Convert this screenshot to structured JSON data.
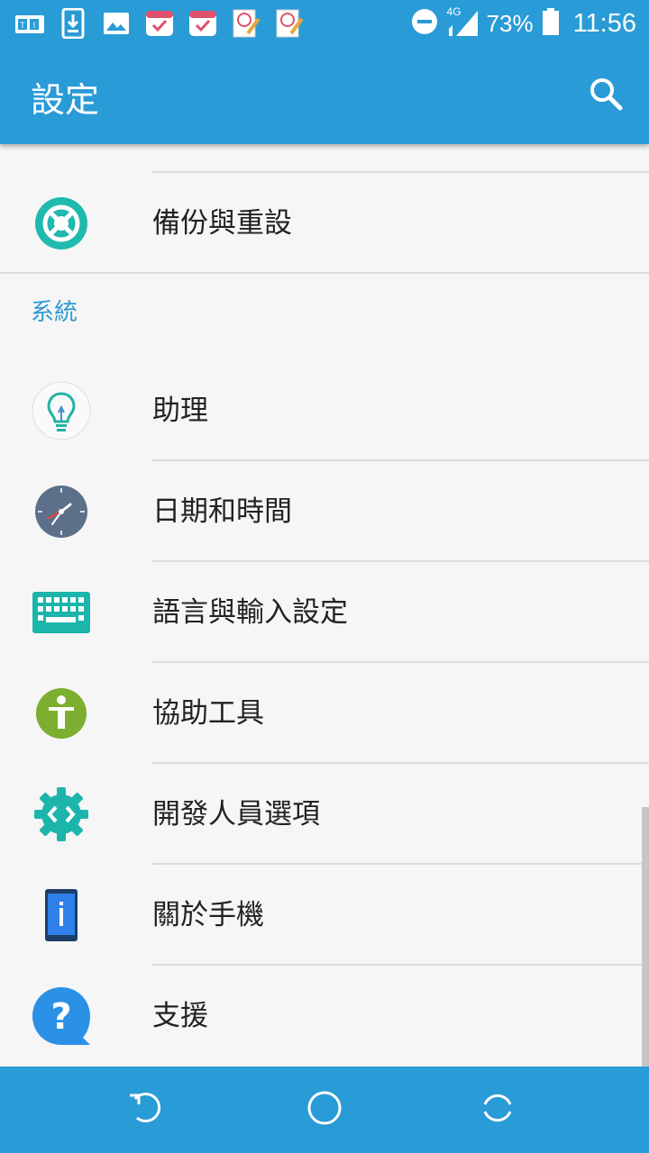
{
  "status_bar": {
    "network": "4G",
    "battery_percent": "73%",
    "battery_level": 0.73,
    "time": "11:56",
    "notification_icons": [
      "tv-icon",
      "download-icon",
      "image-icon",
      "calendar-check-icon",
      "calendar-check-icon",
      "notepad-icon",
      "notepad-icon"
    ]
  },
  "app_bar": {
    "title": "設定",
    "search_icon": "search-icon"
  },
  "settings": {
    "backup_reset": {
      "label": "備份與重設",
      "icon": "backup-icon"
    },
    "section_system": "系統",
    "items": [
      {
        "label": "助理",
        "icon": "lightbulb-icon"
      },
      {
        "label": "日期和時間",
        "icon": "clock-icon"
      },
      {
        "label": "語言與輸入設定",
        "icon": "keyboard-icon"
      },
      {
        "label": "協助工具",
        "icon": "accessibility-icon"
      },
      {
        "label": "開發人員選項",
        "icon": "developer-gear-icon"
      },
      {
        "label": "關於手機",
        "icon": "phone-info-icon"
      },
      {
        "label": "支援",
        "icon": "help-icon"
      }
    ]
  },
  "nav_bar": {
    "back_icon": "back-icon",
    "home_icon": "home-icon",
    "recents_icon": "recents-icon"
  },
  "colors": {
    "primary": "#299bd6",
    "accent_text": "#2c9ad3",
    "background": "#f6f6f6"
  }
}
